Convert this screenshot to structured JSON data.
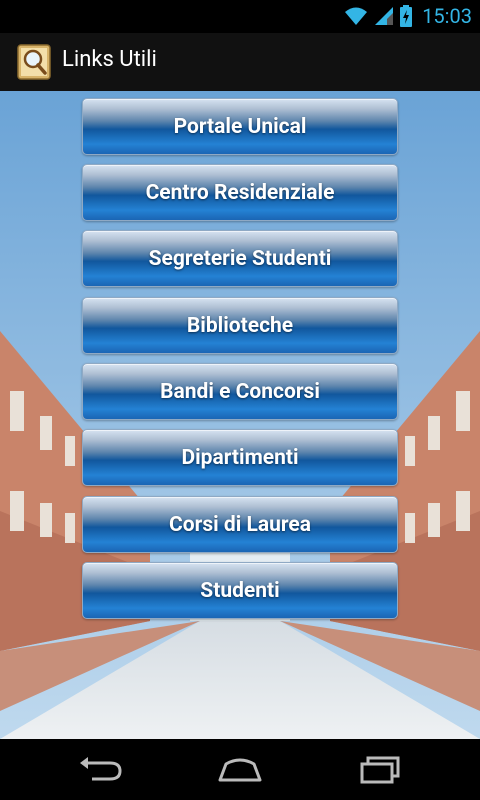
{
  "status_bar": {
    "time": "15:03"
  },
  "action_bar": {
    "title": "Links Utili",
    "icon": "magnifier-scroll-icon"
  },
  "links": [
    {
      "label": "Portale Unical"
    },
    {
      "label": "Centro Residenziale"
    },
    {
      "label": "Segreterie Studenti"
    },
    {
      "label": "Biblioteche"
    },
    {
      "label": "Bandi e Concorsi"
    },
    {
      "label": "Dipartimenti"
    },
    {
      "label": "Corsi di Laurea"
    },
    {
      "label": "Studenti"
    }
  ],
  "nav_bar": {
    "icons": [
      "back-icon",
      "home-icon",
      "recent-apps-icon"
    ]
  },
  "colors": {
    "accent": "#33b5e5",
    "button_blue": "#1565c0"
  }
}
